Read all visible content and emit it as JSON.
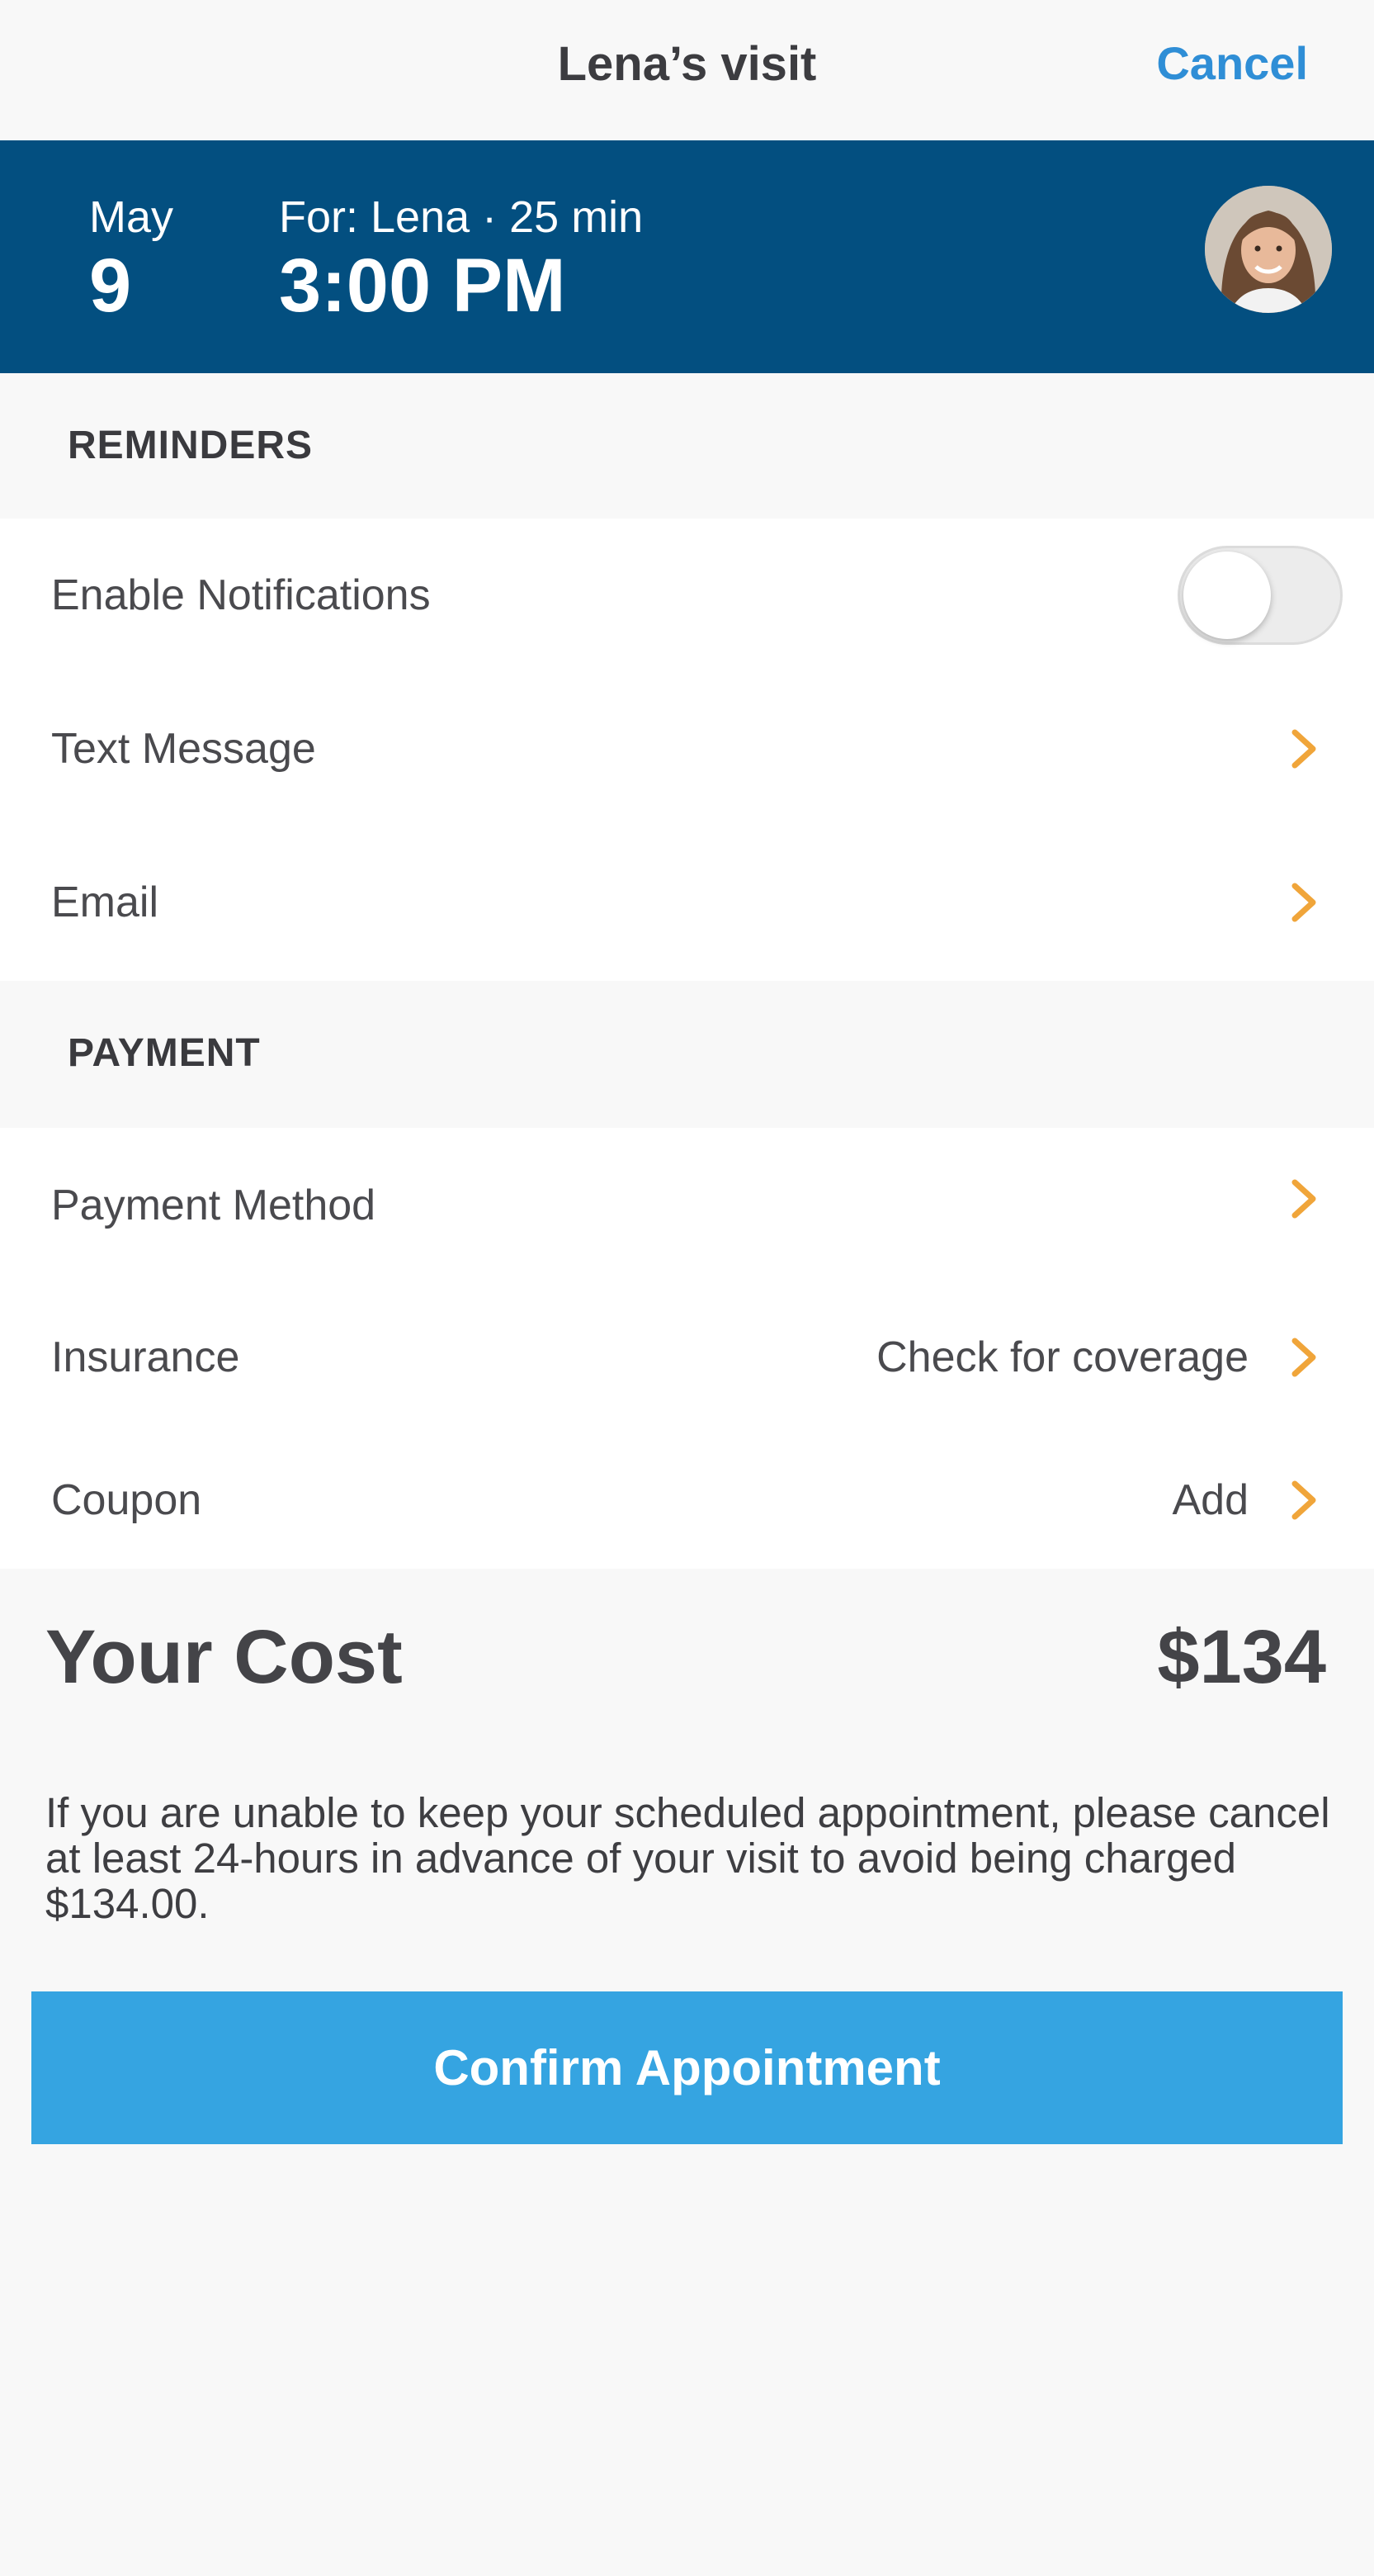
{
  "nav": {
    "title": "Lena’s visit",
    "cancel_label": "Cancel"
  },
  "appointment": {
    "month": "May",
    "day": "9",
    "for_line": "For: Lena · 25 min",
    "time": "3:00 PM",
    "avatar_icon": "person-photo"
  },
  "reminders": {
    "header": "REMINDERS",
    "notifications_label": "Enable Notifications",
    "notifications_enabled": false,
    "text_message_label": "Text Message",
    "email_label": "Email"
  },
  "payment": {
    "header": "PAYMENT",
    "method_label": "Payment Method",
    "insurance_label": "Insurance",
    "insurance_value": "Check for coverage",
    "coupon_label": "Coupon",
    "coupon_value": "Add"
  },
  "cost": {
    "label": "Your Cost",
    "value": "$134"
  },
  "policy_text": "If you are unable to keep your scheduled appointment, please cancel at least 24-hours in advance of your visit to avoid being charged $134.00.",
  "confirm_label": "Confirm Appointment",
  "colors": {
    "banner": "#034f80",
    "accent": "#35a4e1",
    "cancel": "#2f8ed6",
    "chevron": "#f0a53a"
  }
}
